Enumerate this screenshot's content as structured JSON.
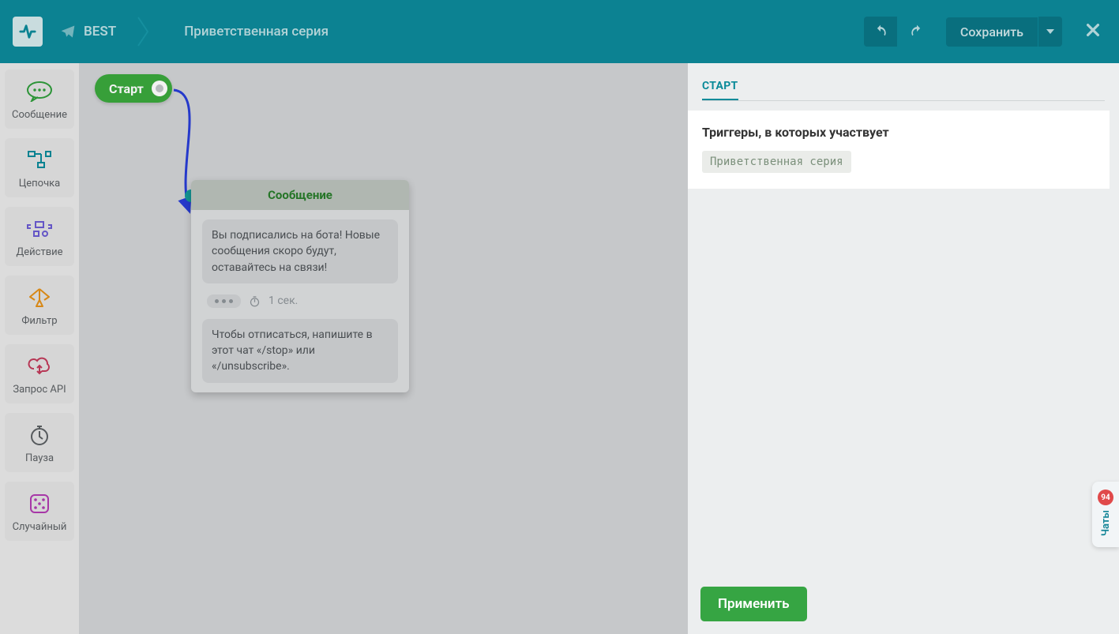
{
  "header": {
    "botName": "BEST",
    "pageTitle": "Приветственная серия",
    "saveLabel": "Сохранить"
  },
  "sidebar": {
    "items": [
      {
        "id": "message",
        "label": "Сообщение"
      },
      {
        "id": "chain",
        "label": "Цепочка"
      },
      {
        "id": "action",
        "label": "Действие"
      },
      {
        "id": "filter",
        "label": "Фильтр"
      },
      {
        "id": "api",
        "label": "Запрос API"
      },
      {
        "id": "pause",
        "label": "Пауза"
      },
      {
        "id": "random",
        "label": "Случайный"
      }
    ]
  },
  "canvas": {
    "startLabel": "Старт",
    "messageCard": {
      "title": "Сообщение",
      "bubble1": "Вы подписались на бота! Новые сообщения скоро будут, оставайтесь на связи!",
      "delayText": "1 сек.",
      "bubble2": "Чтобы отписаться, напишите в этот чат «/stop» или «/unsubscribe»."
    }
  },
  "panel": {
    "tabLabel": "СТАРТ",
    "boxTitle": "Триггеры, в которых участвует",
    "chip": "Приветственная серия",
    "applyLabel": "Применить"
  },
  "chatsTab": {
    "label": "Чаты",
    "badge": "94"
  },
  "colors": {
    "accent": "#0d899a",
    "green": "#36a543"
  }
}
